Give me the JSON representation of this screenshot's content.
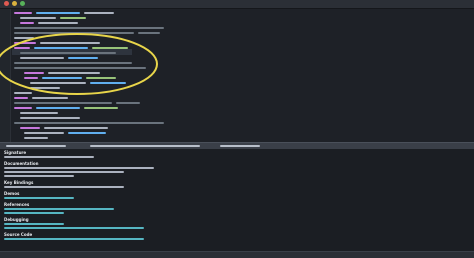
{
  "theme": {
    "background": "#1e2127",
    "keyword": "#c678dd",
    "function": "#61afef",
    "string": "#98c379",
    "comment": "#6a737d",
    "plain": "#abb2bf",
    "link": "#56b6c2",
    "annotation": "#e8d54a"
  },
  "help": {
    "sections": [
      {
        "id": "signature",
        "title": "Signature"
      },
      {
        "id": "documentation",
        "title": "Documentation"
      },
      {
        "id": "key-bindings",
        "title": "Key Bindings"
      },
      {
        "id": "demos",
        "title": "Demos"
      },
      {
        "id": "references",
        "title": "References"
      },
      {
        "id": "debugging",
        "title": "Debugging"
      },
      {
        "id": "source-code",
        "title": "Source Code"
      }
    ]
  },
  "annotation": {
    "shape": "ellipse",
    "color": "#e8d54a"
  }
}
